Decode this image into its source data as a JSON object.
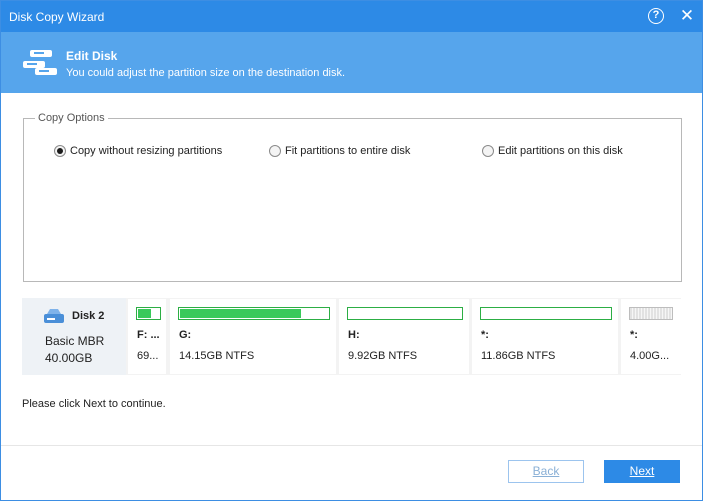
{
  "window": {
    "title": "Disk Copy Wizard"
  },
  "header": {
    "title": "Edit Disk",
    "subtitle": "You could adjust the partition size on the destination disk."
  },
  "copy_options": {
    "legend": "Copy Options",
    "options": [
      {
        "label": "Copy without resizing partitions",
        "checked": true
      },
      {
        "label": "Fit partitions to entire disk",
        "checked": false
      },
      {
        "label": "Edit partitions on this disk",
        "checked": false
      }
    ]
  },
  "disk": {
    "name": "Disk 2",
    "type": "Basic MBR",
    "size": "40.00GB",
    "partitions": [
      {
        "label": "F: ...",
        "info": "69...",
        "used_fraction": 0.6
      },
      {
        "label": "G:",
        "info": "14.15GB NTFS",
        "used_fraction": 0.82
      },
      {
        "label": "H:",
        "info": "9.92GB NTFS",
        "used_fraction": 0.0
      },
      {
        "label": "*:",
        "info": "11.86GB NTFS",
        "used_fraction": 0.0
      },
      {
        "label": "*:",
        "info": "4.00G...",
        "used_fraction": 0.0
      }
    ]
  },
  "hint": "Please click Next to continue.",
  "buttons": {
    "back": "Back",
    "next": "Next"
  },
  "colors": {
    "titlebar": "#2d8ae6",
    "header": "#56a5ec",
    "partition_used": "#39c95a"
  }
}
